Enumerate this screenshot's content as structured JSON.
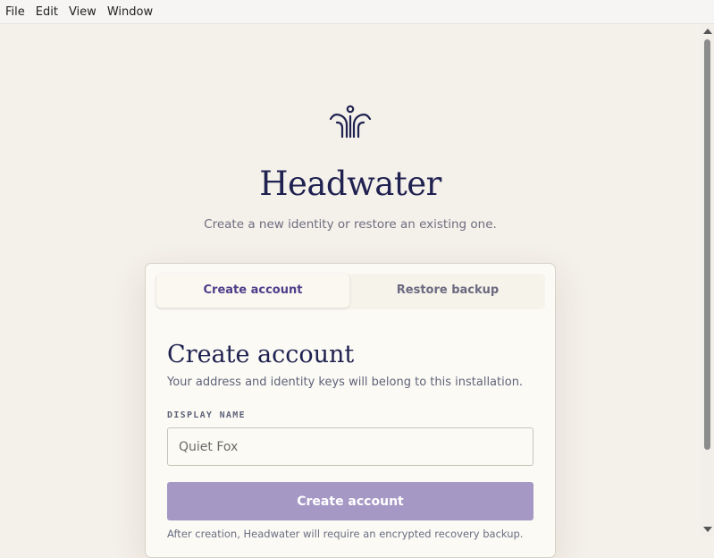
{
  "menu": [
    "File",
    "Edit",
    "View",
    "Window"
  ],
  "app": {
    "title": "Headwater",
    "subtitle": "Create a new identity or restore an existing one.",
    "logo_icon": "fountain-logo-icon",
    "accent_color": "#1f2150"
  },
  "tabs": [
    {
      "label": "Create account",
      "active": true
    },
    {
      "label": "Restore backup",
      "active": false
    }
  ],
  "form": {
    "heading": "Create account",
    "description": "Your address and identity keys will belong to this installation.",
    "display_name_label": "DISPLAY NAME",
    "display_name_placeholder": "Quiet Fox",
    "display_name_value": "",
    "submit_label": "Create account",
    "submit_color": "#a598c5",
    "footnote": "After creation, Headwater will require an encrypted recovery backup."
  }
}
